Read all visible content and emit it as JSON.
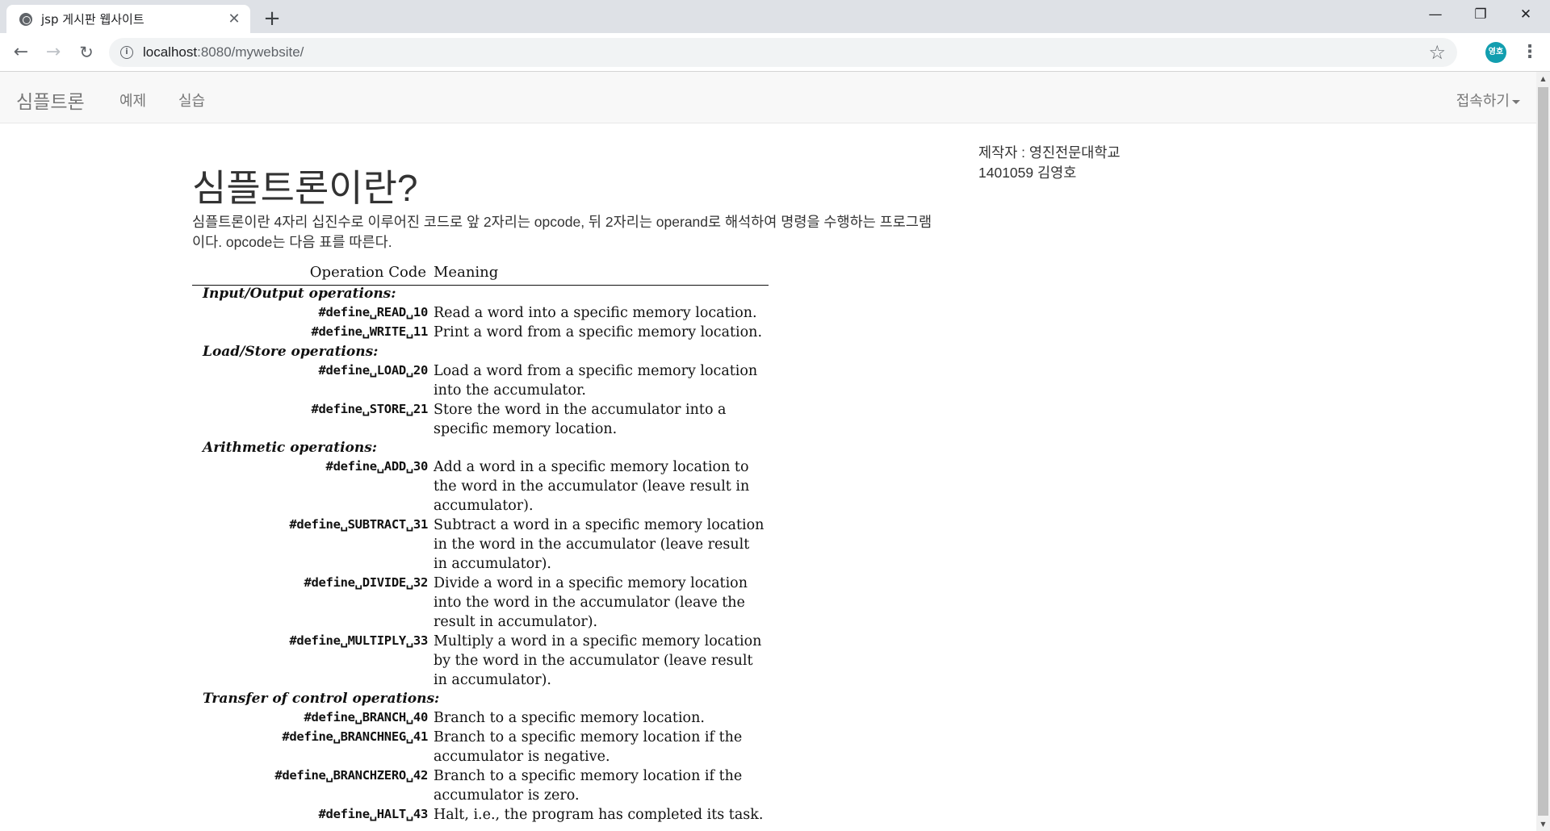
{
  "browser": {
    "tab_title": "jsp 게시판 웹사이트",
    "tab_close": "✕",
    "new_tab": "+",
    "window_controls": {
      "minimize": "—",
      "maximize": "❐",
      "close": "✕"
    },
    "nav": {
      "back": "←",
      "forward": "→",
      "reload": "↻"
    },
    "url_host": "localhost",
    "url_rest": ":8080/mywebsite/",
    "bookmark_star": "☆",
    "profile_label": "영호",
    "menu": "⋮"
  },
  "navbar": {
    "brand": "심플트론",
    "links": [
      "예제",
      "실습"
    ],
    "dropdown": "접속하기"
  },
  "main": {
    "title": "심플트론이란?",
    "intro": "심플트론이란 4자리 십진수로 이루어진 코드로 앞 2자리는 opcode, 뒤 2자리는 operand로 해석하여 명령을 수행하는 프로그램이다. opcode는 다음 표를 따른다."
  },
  "author": {
    "line1": "제작자 : 영진전문대학교",
    "line2": "1401059 김영호"
  },
  "opcode_table": {
    "header_code": "Operation Code",
    "header_meaning": "Meaning",
    "sections": {
      "io": "Input/Output operations:",
      "loadstore": "Load/Store operations:",
      "arith": "Arithmetic operations:",
      "control": "Transfer of control operations:"
    },
    "rows": [
      {
        "code": "#define␣READ␣10",
        "meaning": "Read a word into a specific memory location."
      },
      {
        "code": "#define␣WRITE␣11",
        "meaning": "Print a word from a specific memory location."
      },
      {
        "code": "#define␣LOAD␣20",
        "meaning": "Load a word from a specific memory location into the accumulator."
      },
      {
        "code": "#define␣STORE␣21",
        "meaning": "Store the word in the accumulator into a specific memory location."
      },
      {
        "code": "#define␣ADD␣30",
        "meaning": "Add a word in a specific memory location to the word in the accumulator (leave result in accumulator)."
      },
      {
        "code": "#define␣SUBTRACT␣31",
        "meaning": "Subtract a word in a specific memory location in the word in the accumulator (leave result in accumulator)."
      },
      {
        "code": "#define␣DIVIDE␣32",
        "meaning": "Divide a word in a specific memory location into the word in the accumulator (leave the result in accumulator)."
      },
      {
        "code": "#define␣MULTIPLY␣33",
        "meaning": "Multiply a word in a specific memory location by the word in the accumulator (leave result in accumulator)."
      },
      {
        "code": "#define␣BRANCH␣40",
        "meaning": "Branch to a specific memory location."
      },
      {
        "code": "#define␣BRANCHNEG␣41",
        "meaning": "Branch to a specific memory location if the accumulator is negative."
      },
      {
        "code": "#define␣BRANCHZERO␣42",
        "meaning": "Branch to a specific memory location if the accumulator is zero."
      },
      {
        "code": "#define␣HALT␣43",
        "meaning": "Halt, i.e., the program has completed its task."
      }
    ]
  }
}
